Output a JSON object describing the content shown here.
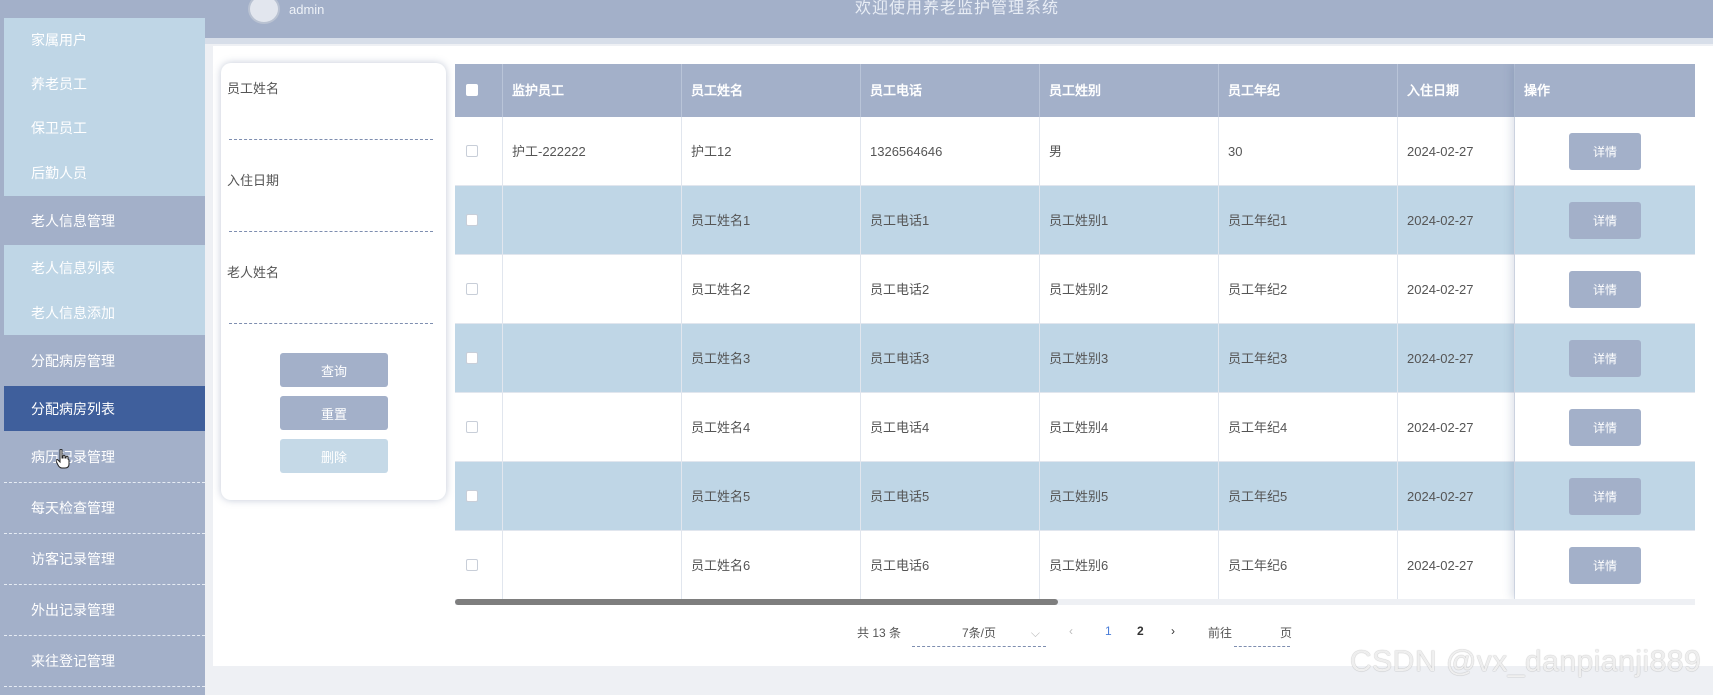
{
  "header": {
    "user": "admin",
    "welcome": "欢迎使用养老监护管理系统"
  },
  "sidebar": {
    "items": [
      {
        "label": "家属用户"
      },
      {
        "label": "养老员工"
      },
      {
        "label": "保卫员工"
      },
      {
        "label": "后勤人员"
      },
      {
        "label": "老人信息管理"
      },
      {
        "label": "老人信息列表"
      },
      {
        "label": "老人信息添加"
      },
      {
        "label": "分配病房管理"
      },
      {
        "label": "分配病房列表"
      },
      {
        "label": "病历记录管理"
      },
      {
        "label": "每天检查管理"
      },
      {
        "label": "访客记录管理"
      },
      {
        "label": "外出记录管理"
      },
      {
        "label": "来往登记管理"
      }
    ]
  },
  "search": {
    "fields": [
      {
        "label": "员工姓名",
        "value": ""
      },
      {
        "label": "入住日期",
        "value": ""
      },
      {
        "label": "老人姓名",
        "value": ""
      }
    ],
    "query_label": "查询",
    "reset_label": "重置",
    "delete_label": "删除"
  },
  "table": {
    "columns": [
      "监护员工",
      "员工姓名",
      "员工电话",
      "员工姓别",
      "员工年纪",
      "入住日期",
      "操作"
    ],
    "detail_label": "详情",
    "rows": [
      {
        "guardian": "护工-222222",
        "name": "护工12",
        "phone": "1326564646",
        "gender": "男",
        "age": "30",
        "date": "2024-02-27"
      },
      {
        "guardian": "",
        "name": "员工姓名1",
        "phone": "员工电话1",
        "gender": "员工姓别1",
        "age": "员工年纪1",
        "date": "2024-02-27"
      },
      {
        "guardian": "",
        "name": "员工姓名2",
        "phone": "员工电话2",
        "gender": "员工姓别2",
        "age": "员工年纪2",
        "date": "2024-02-27"
      },
      {
        "guardian": "",
        "name": "员工姓名3",
        "phone": "员工电话3",
        "gender": "员工姓别3",
        "age": "员工年纪3",
        "date": "2024-02-27"
      },
      {
        "guardian": "",
        "name": "员工姓名4",
        "phone": "员工电话4",
        "gender": "员工姓别4",
        "age": "员工年纪4",
        "date": "2024-02-27"
      },
      {
        "guardian": "",
        "name": "员工姓名5",
        "phone": "员工电话5",
        "gender": "员工姓别5",
        "age": "员工年纪5",
        "date": "2024-02-27"
      },
      {
        "guardian": "",
        "name": "员工姓名6",
        "phone": "员工电话6",
        "gender": "员工姓别6",
        "age": "员工年纪6",
        "date": "2024-02-27"
      }
    ]
  },
  "pagination": {
    "total": "共 13 条",
    "page_size": "7条/页",
    "pages": [
      "1",
      "2"
    ],
    "current": "1",
    "goto_label": "前往",
    "goto_suffix": "页",
    "goto_value": ""
  },
  "watermark": "CSDN @vx_danpianji889"
}
